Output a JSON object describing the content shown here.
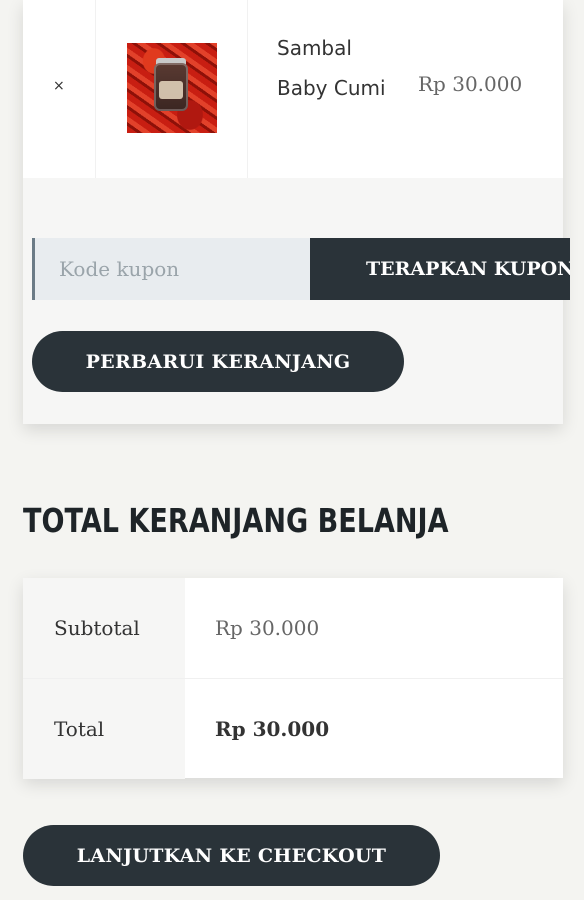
{
  "cart": {
    "item": {
      "remove_symbol": "×",
      "name": "Sambal Baby Cumi",
      "price": "Rp 30.000",
      "thumbnail": "product-image"
    },
    "coupon": {
      "placeholder": "Kode kupon",
      "apply_label": "TERAPKAN KUPON"
    },
    "update_label": "PERBARUI KERANJANG"
  },
  "totals": {
    "title": "TOTAL KERANJANG BELANJA",
    "rows": [
      {
        "label": "Subtotal",
        "value": "Rp 30.000"
      },
      {
        "label": "Total",
        "value": "Rp 30.000"
      }
    ]
  },
  "checkout_label": "LANJUTKAN KE CHECKOUT",
  "colors": {
    "button_dark": "#2a3339",
    "page_bg": "#f4f4f1"
  }
}
